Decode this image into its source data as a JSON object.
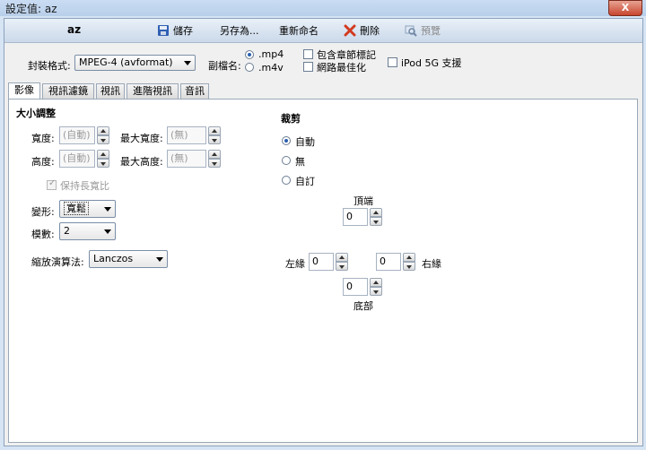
{
  "window": {
    "title": "設定值: az",
    "close_label": "X"
  },
  "toolbar": {
    "preset_name": "az",
    "save_label": "儲存",
    "save_as_label": "另存為...",
    "rename_label": "重新命名",
    "delete_label": "刪除",
    "preview_label": "預覽"
  },
  "container": {
    "format_label": "封裝格式:",
    "format_value": "MPEG-4 (avformat)",
    "ext_label": "副檔名:",
    "ext_options": [
      ".mp4",
      ".m4v"
    ],
    "ext_selected": ".mp4",
    "chapter_markers_label": "包含章節標記",
    "web_optimized_label": "網路最佳化",
    "ipod_label": "iPod 5G 支援"
  },
  "tabs": [
    "影像",
    "視訊濾鏡",
    "視訊",
    "進階視訊",
    "音訊"
  ],
  "active_tab": "影像",
  "size": {
    "section_title": "大小調整",
    "width_label": "寬度:",
    "width_value": "(自動)",
    "max_width_label": "最大寬度:",
    "max_width_value": "(無)",
    "height_label": "高度:",
    "height_value": "(自動)",
    "max_height_label": "最大高度:",
    "max_height_value": "(無)",
    "keep_aspect_label": "保持長寬比",
    "anamorphic_label": "變形:",
    "anamorphic_value": "寬鬆",
    "modulus_label": "模數:",
    "modulus_value": "2",
    "scaler_label": "縮放演算法:",
    "scaler_value": "Lanczos"
  },
  "crop": {
    "section_title": "裁剪",
    "options": [
      "自動",
      "無",
      "自訂"
    ],
    "selected": "自動",
    "top_label": "頂端",
    "top_value": "0",
    "left_label": "左緣",
    "left_value": "0",
    "right_label": "右緣",
    "right_value": "0",
    "bottom_label": "底部",
    "bottom_value": "0"
  },
  "colors": {
    "accent": "#2a5fae",
    "delete_red": "#d23a1f",
    "save_blue": "#2f5fb3"
  }
}
